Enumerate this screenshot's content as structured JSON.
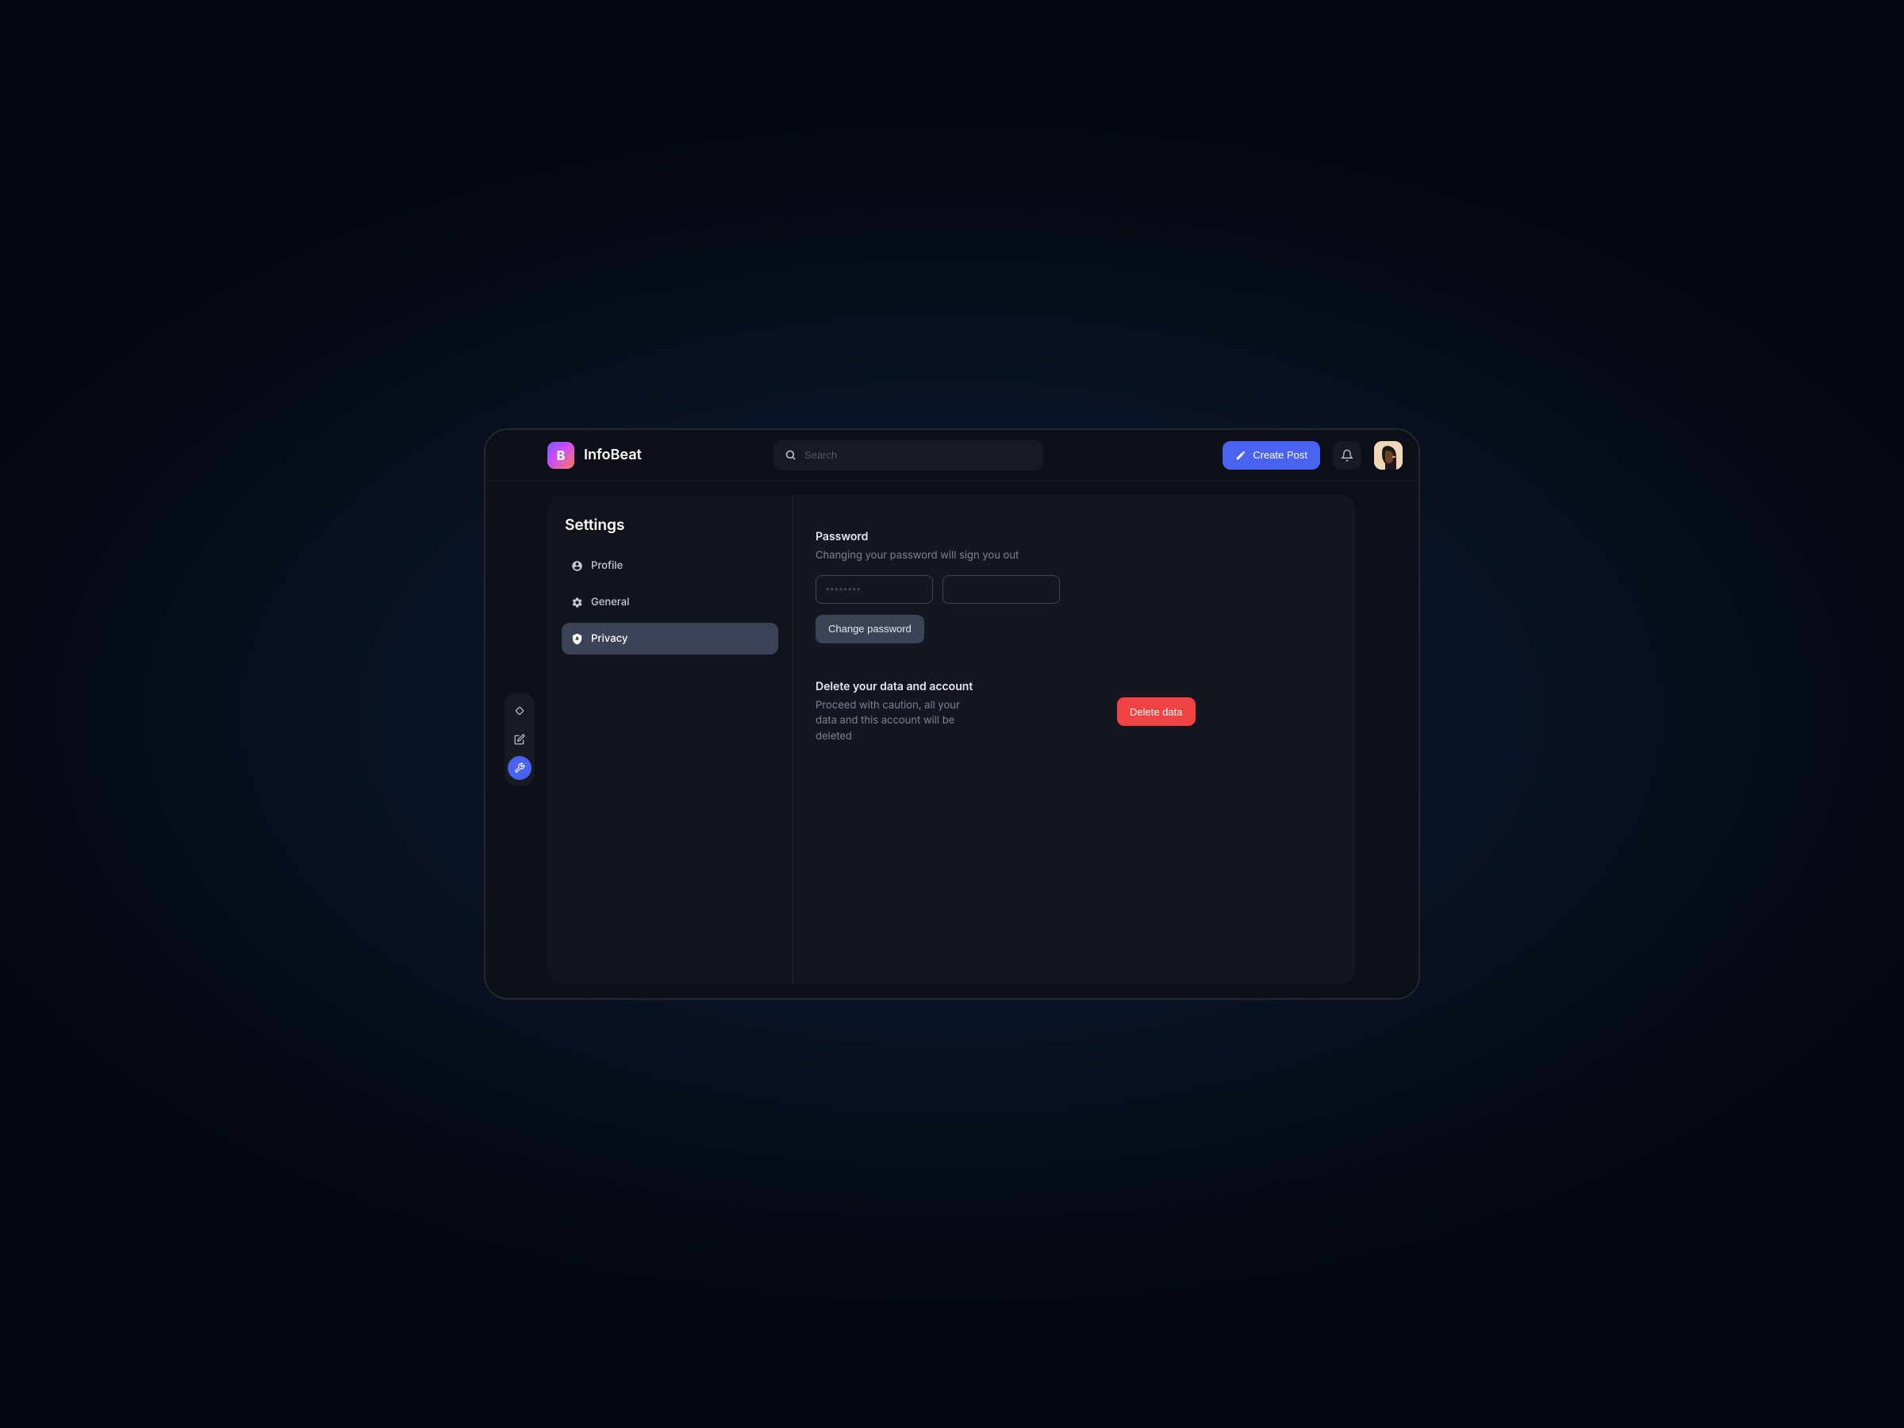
{
  "brand": {
    "logo_letter": "B",
    "name": "InfoBeat"
  },
  "header": {
    "search_placeholder": "Search",
    "create_post": "Create Post"
  },
  "sidebar": {
    "title": "Settings",
    "items": [
      {
        "label": "Profile"
      },
      {
        "label": "General"
      },
      {
        "label": "Privacy"
      }
    ],
    "active_index": 2
  },
  "privacy": {
    "password": {
      "title": "Password",
      "subtitle": "Changing your password will sign you out",
      "current_placeholder": "••••••••",
      "new_placeholder": "",
      "button": "Change password"
    },
    "delete": {
      "title": "Delete your data and account",
      "subtitle": "Proceed with caution, all your data and this account will be deleted",
      "button": "Delete data"
    }
  },
  "colors": {
    "accent": "#4a62f0",
    "danger": "#ef4343",
    "panel": "#141720",
    "bg": "#0d1018"
  }
}
